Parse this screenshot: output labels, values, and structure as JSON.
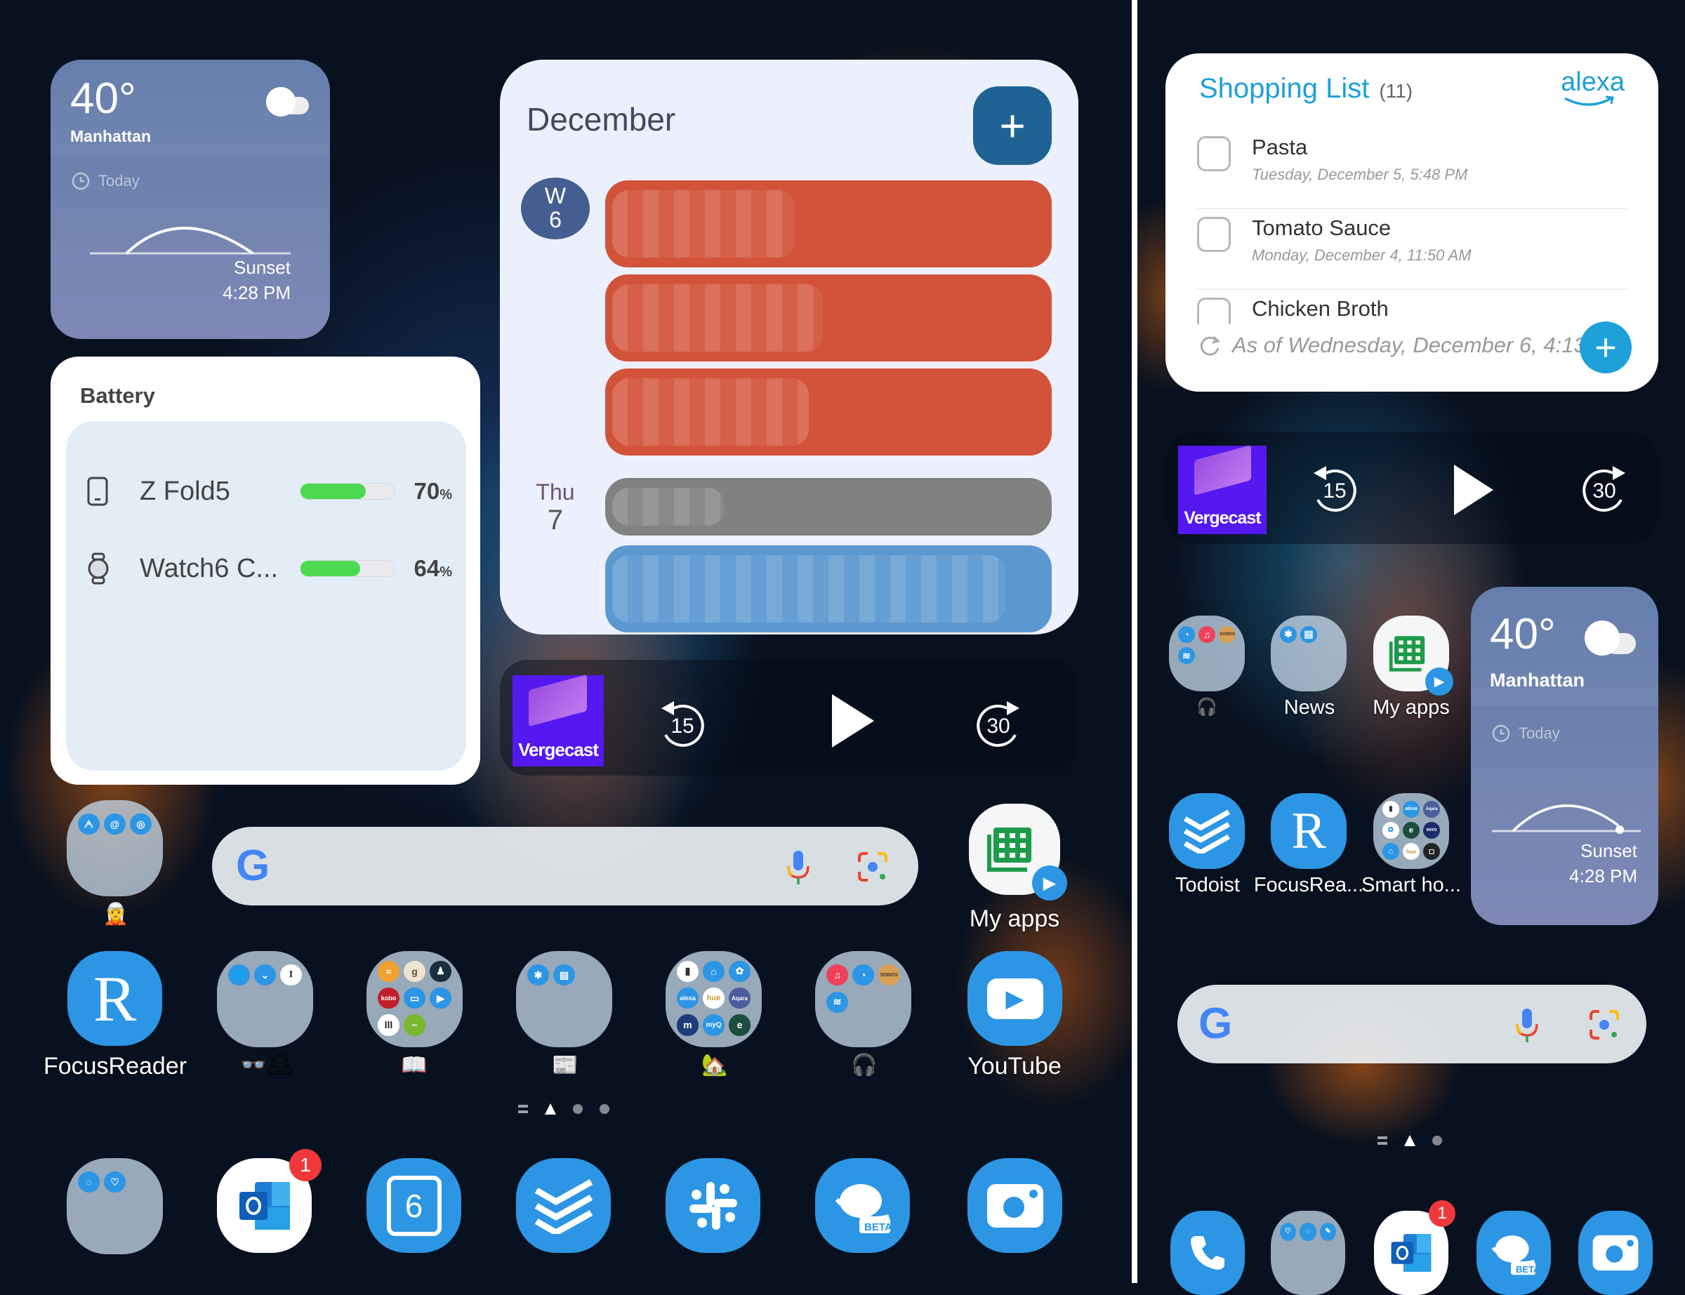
{
  "left_screen": {
    "weather": {
      "temperature": "40°",
      "city": "Manhattan",
      "period": "Today",
      "sunset_label": "Sunset",
      "sunset_time": "4:28 PM",
      "condition_icon": "cloudy-icon"
    },
    "battery": {
      "title": "Battery",
      "devices": [
        {
          "name": "Z Fold5",
          "percent": 70,
          "percent_text": "70",
          "icon": "phone-icon"
        },
        {
          "name": "Watch6 C...",
          "percent": 64,
          "percent_text": "64",
          "icon": "watch-icon"
        }
      ],
      "percent_sign": "%"
    },
    "calendar": {
      "month": "December",
      "add_label": "+",
      "days": [
        {
          "weekday": "W",
          "day": "6",
          "today": true,
          "events": [
            {
              "color": "#d3533a"
            },
            {
              "color": "#d3533a"
            },
            {
              "color": "#d3533a"
            }
          ]
        },
        {
          "weekday": "Thu",
          "day": "7",
          "today": false,
          "events": [
            {
              "color": "#818181"
            },
            {
              "color": "#5b98d0"
            }
          ]
        }
      ]
    },
    "podcast": {
      "title": "The Vergecast",
      "cover_text": "Vergecast",
      "rewind_seconds": "15",
      "forward_seconds": "30"
    },
    "search": {
      "logo": "G"
    },
    "apps": {
      "social_folder": {
        "mini": [
          "Mastodon",
          "Threads",
          "Instagram"
        ],
        "label_emoji": "🧝"
      },
      "my_apps": {
        "label": "My apps"
      },
      "row": [
        {
          "type": "app",
          "label": "FocusReader",
          "glyph": "R"
        },
        {
          "type": "folder",
          "label": "👓🕰",
          "mini": [
            "Earth",
            "Pocket",
            "Instapaper"
          ]
        },
        {
          "type": "folder",
          "label": "📖",
          "mini": [
            "Audible",
            "Goodreads",
            "Kindle",
            "Kobo",
            "Libby",
            "Play Books",
            "Libro",
            "Nook"
          ]
        },
        {
          "type": "folder",
          "label": "📰",
          "mini": [
            "Perplexity",
            "News"
          ]
        },
        {
          "type": "folder",
          "label": "🏡",
          "mini": [
            "SmartThings",
            "Home",
            "Nest",
            "alexa",
            "hue",
            "Aqara",
            "Matter",
            "myQ",
            "Ecobee"
          ]
        },
        {
          "type": "folder",
          "label": "🎧",
          "mini": [
            "Music",
            "Pocket Casts",
            "Sonos",
            "Spotify"
          ]
        },
        {
          "type": "app",
          "label": "YouTube",
          "glyph": "▶"
        }
      ],
      "dock": [
        {
          "name": "Messages folder",
          "type": "folder"
        },
        {
          "name": "Outlook",
          "badge": "1"
        },
        {
          "name": "Calendar",
          "glyph": "6"
        },
        {
          "name": "Todoist"
        },
        {
          "name": "Slack"
        },
        {
          "name": "Internet Beta",
          "glyph": "BETA"
        },
        {
          "name": "Camera"
        }
      ]
    },
    "pages": {
      "count": 3,
      "current": 1
    }
  },
  "right_screen": {
    "shopping_list": {
      "title": "Shopping List",
      "count": "(11)",
      "brand": "alexa",
      "items": [
        {
          "name": "Pasta",
          "date": "Tuesday, December 5, 5:48 PM",
          "checked": false
        },
        {
          "name": "Tomato Sauce",
          "date": "Monday, December 4, 11:50 AM",
          "checked": false
        },
        {
          "name": "Chicken Broth",
          "date": "",
          "checked": false
        }
      ],
      "sync_status": "As of Wednesday, December 6, 4:13"
    },
    "podcast": {
      "title": "The Vergecast",
      "cover_text": "Vergecast",
      "rewind_seconds": "15",
      "forward_seconds": "30"
    },
    "apps": {
      "row1": [
        {
          "type": "folder",
          "label": "🎧",
          "mini": [
            "Pocket Casts",
            "Music",
            "Sonos",
            "Spotify"
          ]
        },
        {
          "type": "folder",
          "label": "News",
          "mini": [
            "Perplexity",
            "News"
          ]
        },
        {
          "type": "app",
          "label": "My apps"
        }
      ],
      "row2": [
        {
          "type": "app",
          "label": "Todoist"
        },
        {
          "type": "app",
          "label": "FocusRea...",
          "glyph": "R"
        },
        {
          "type": "folder",
          "label": "Smart ho..."
        }
      ],
      "dock": [
        {
          "name": "Phone"
        },
        {
          "name": "Messages folder",
          "type": "folder"
        },
        {
          "name": "Outlook",
          "badge": "1"
        },
        {
          "name": "Internet Beta",
          "glyph": "BETA"
        },
        {
          "name": "Camera"
        }
      ]
    },
    "weather": {
      "temperature": "40°",
      "city": "Manhattan",
      "period": "Today",
      "sunset_label": "Sunset",
      "sunset_time": "4:28 PM"
    },
    "search": {
      "logo": "G"
    },
    "pages": {
      "count": 2,
      "current": 1
    }
  }
}
